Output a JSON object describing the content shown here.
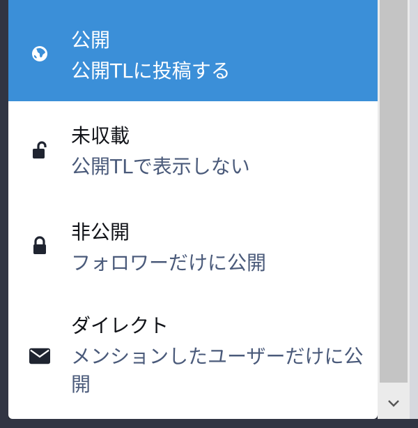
{
  "privacy_dropdown": {
    "options": [
      {
        "title": "公開",
        "description": "公開TLに投稿する",
        "icon": "globe-icon",
        "selected": true
      },
      {
        "title": "未収載",
        "description": "公開TLで表示しない",
        "icon": "unlock-icon",
        "selected": false
      },
      {
        "title": "非公開",
        "description": "フォロワーだけに公開",
        "icon": "lock-icon",
        "selected": false
      },
      {
        "title": "ダイレクト",
        "description": "メンションしたユーザーだけに公開",
        "icon": "envelope-icon",
        "selected": false
      }
    ]
  },
  "colors": {
    "selected_bg": "#3b8fd8",
    "description_text": "#4a5a7a",
    "title_text": "#111318",
    "icon_dark": "#1f2430"
  },
  "scrollbar": {
    "down_arrow_icon": "chevron-down-icon"
  }
}
